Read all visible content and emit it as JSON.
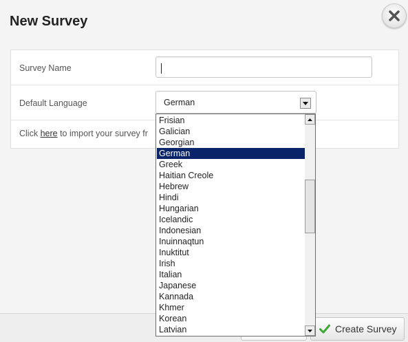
{
  "dialog": {
    "title": "New Survey",
    "close_icon": "close-icon"
  },
  "form": {
    "survey_name_label": "Survey Name",
    "survey_name_value": "",
    "default_language_label": "Default Language",
    "default_language_value": "German",
    "import_prefix": "Click ",
    "import_link": "here",
    "import_suffix": " to import your survey fr"
  },
  "language_options": [
    "Frisian",
    "Galician",
    "Georgian",
    "German",
    "Greek",
    "Haitian Creole",
    "Hebrew",
    "Hindi",
    "Hungarian",
    "Icelandic",
    "Indonesian",
    "Inuinnaqtun",
    "Inuktitut",
    "Irish",
    "Italian",
    "Japanese",
    "Kannada",
    "Khmer",
    "Korean",
    "Latvian"
  ],
  "selected_option": "German",
  "footer": {
    "create_label": "Create Survey",
    "create_icon": "checkmark-icon"
  },
  "colors": {
    "selection": "#0a246a",
    "check_green": "#3aa832"
  }
}
